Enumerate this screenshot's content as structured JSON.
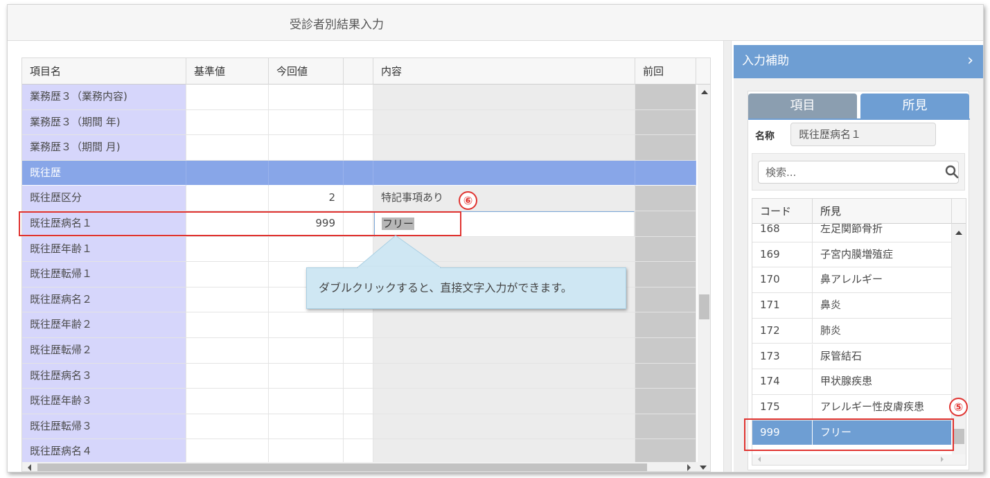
{
  "window": {
    "title": "受診者別結果入力"
  },
  "grid": {
    "columns": [
      "項目名",
      "基準値",
      "今回値",
      "",
      "内容",
      "前回"
    ],
    "rows": [
      {
        "name": "業務歴３（業務内容)",
        "standard": "",
        "current": "",
        "content": "",
        "type": "item"
      },
      {
        "name": "業務歴３（期間 年)",
        "standard": "",
        "current": "",
        "content": "",
        "type": "item"
      },
      {
        "name": "業務歴３（期間 月)",
        "standard": "",
        "current": "",
        "content": "",
        "type": "item"
      },
      {
        "name": "既往歴",
        "standard": "",
        "current": "",
        "content": "",
        "type": "section"
      },
      {
        "name": "既往歴区分",
        "standard": "",
        "current": "2",
        "content": "特記事項あり",
        "type": "item"
      },
      {
        "name": "既往歴病名１",
        "standard": "",
        "current": "999",
        "content": "フリー",
        "type": "editing"
      },
      {
        "name": "既往歴年齢１",
        "standard": "",
        "current": "",
        "content": "",
        "type": "item"
      },
      {
        "name": "既往歴転帰１",
        "standard": "",
        "current": "",
        "content": "",
        "type": "item"
      },
      {
        "name": "既往歴病名２",
        "standard": "",
        "current": "",
        "content": "",
        "type": "item"
      },
      {
        "name": "既往歴年齢２",
        "standard": "",
        "current": "",
        "content": "",
        "type": "item"
      },
      {
        "name": "既往歴転帰２",
        "standard": "",
        "current": "",
        "content": "",
        "type": "item"
      },
      {
        "name": "既往歴病名３",
        "standard": "",
        "current": "",
        "content": "",
        "type": "item"
      },
      {
        "name": "既往歴年齢３",
        "standard": "",
        "current": "",
        "content": "",
        "type": "item"
      },
      {
        "name": "既往歴転帰３",
        "standard": "",
        "current": "",
        "content": "",
        "type": "item"
      }
    ],
    "partial_row": {
      "name": "既往歴病名４"
    }
  },
  "tooltip": {
    "text": "ダブルクリックすると、直接文字入力ができます。"
  },
  "annotations": {
    "badge_edit": "⑥",
    "badge_select": "⑤"
  },
  "panel": {
    "title": "入力補助",
    "tabs": {
      "item": "項目",
      "finding": "所見"
    },
    "name_label": "名称",
    "name_value": "既往歴病名１",
    "search": {
      "placeholder": "検索..."
    },
    "list": {
      "columns": [
        "コード",
        "所見"
      ],
      "rows": [
        {
          "code": "168",
          "finding": "左足関節骨折"
        },
        {
          "code": "169",
          "finding": "子宮内膜増殖症"
        },
        {
          "code": "170",
          "finding": "鼻アレルギー"
        },
        {
          "code": "171",
          "finding": "鼻炎"
        },
        {
          "code": "172",
          "finding": "肺炎"
        },
        {
          "code": "173",
          "finding": "尿管結石"
        },
        {
          "code": "174",
          "finding": "甲状腺疾患"
        },
        {
          "code": "175",
          "finding": "アレルギー性皮膚疾患"
        },
        {
          "code": "999",
          "finding": "フリー",
          "selected": true
        }
      ]
    }
  },
  "colors": {
    "accent": "#6e9ed3",
    "section_row": "#88a6e8",
    "name_column": "#d6d6fb",
    "annotation": "#e0322f"
  }
}
